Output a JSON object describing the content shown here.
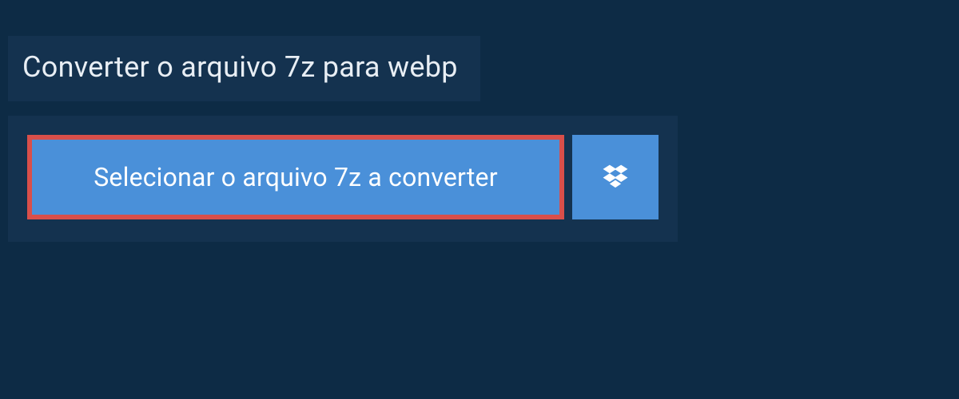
{
  "header": {
    "title": "Converter o arquivo 7z para webp"
  },
  "actions": {
    "select_file_label": "Selecionar o arquivo 7z a converter"
  },
  "icons": {
    "dropbox": "dropbox-icon"
  }
}
